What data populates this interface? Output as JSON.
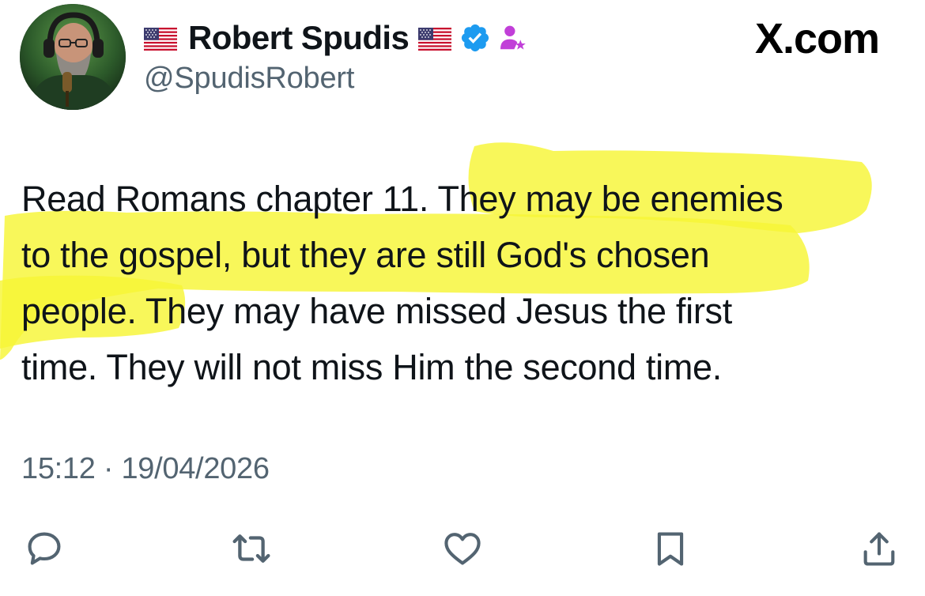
{
  "header": {
    "display_name": "Robert Spudis",
    "handle": "@SpudisRobert",
    "site_label": "X.com",
    "verified_icon": "verified-badge-icon",
    "affiliate_icon": "affiliate-person-icon",
    "flag_icon": "us-flag-icon"
  },
  "tweet": {
    "lines": [
      "Read Romans chapter 11. They may be enemies",
      "to the gospel, but they are still God's chosen",
      "people. They may have missed Jesus the first",
      "time. They will not miss Him the second time."
    ],
    "timestamp": "15:12 · 19/04/2026",
    "highlight_color": "#f6f536"
  },
  "actions": [
    {
      "icon": "reply-icon"
    },
    {
      "icon": "retweet-icon"
    },
    {
      "icon": "like-icon"
    },
    {
      "icon": "bookmark-icon"
    },
    {
      "icon": "share-icon"
    }
  ],
  "colors": {
    "text": "#0f1419",
    "secondary": "#536471",
    "verified": "#1d9bf0",
    "affiliate": "#c13fd8"
  }
}
